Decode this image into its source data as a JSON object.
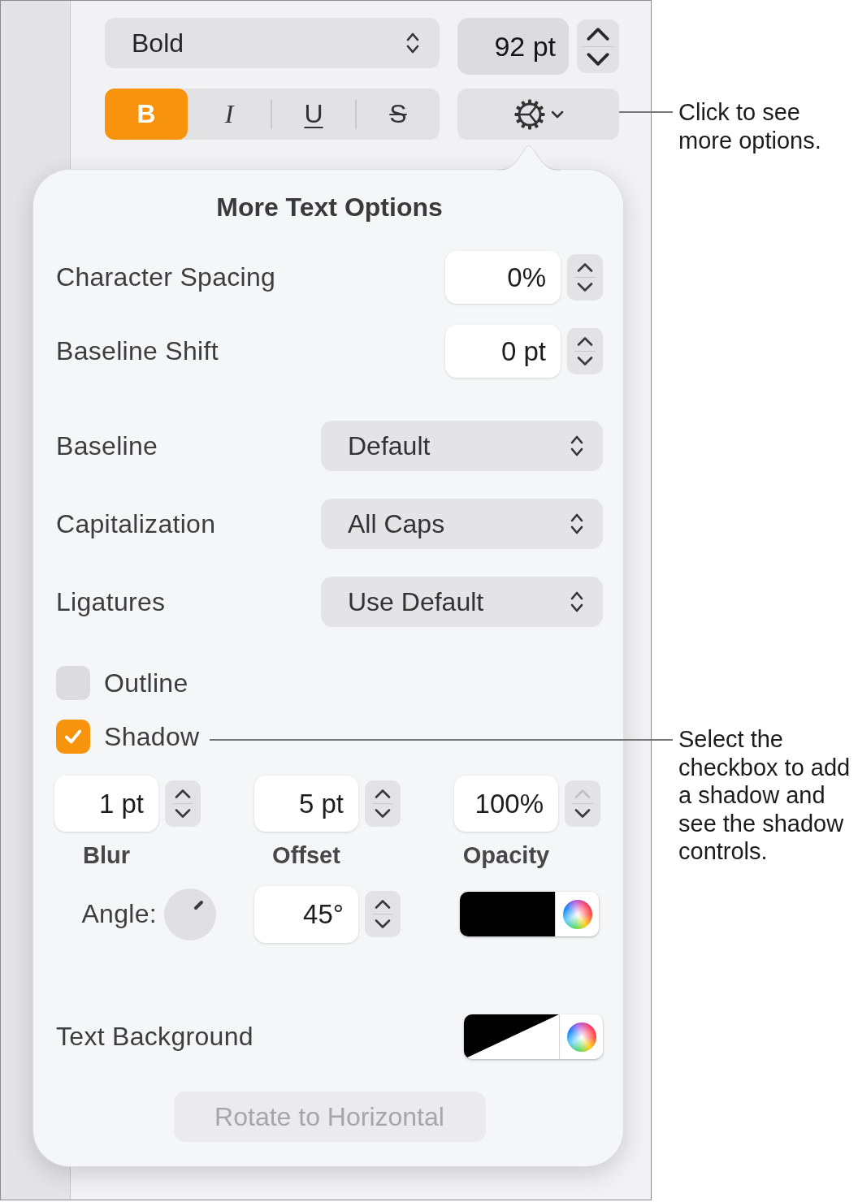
{
  "toolbar": {
    "font_style": {
      "value": "Bold"
    },
    "font_size": {
      "value": "92 pt"
    },
    "style_buttons": [
      {
        "kind": "bold",
        "label": "B",
        "selected": true
      },
      {
        "kind": "italic",
        "label": "I",
        "selected": false
      },
      {
        "kind": "underline",
        "label": "U",
        "selected": false
      },
      {
        "kind": "strikethrough",
        "label": "S",
        "selected": false
      }
    ]
  },
  "popover": {
    "title": "More Text Options",
    "number_fields": [
      {
        "label": "Character Spacing",
        "value": "0%"
      },
      {
        "label": "Baseline Shift",
        "value": "0 pt"
      }
    ],
    "dropdowns": [
      {
        "label": "Baseline",
        "value": "Default"
      },
      {
        "label": "Capitalization",
        "value": "All Caps"
      },
      {
        "label": "Ligatures",
        "value": "Use Default"
      }
    ],
    "checkboxes": [
      {
        "label": "Outline",
        "checked": false
      },
      {
        "label": "Shadow",
        "checked": true
      }
    ],
    "shadow": {
      "controls": [
        {
          "label": "Blur",
          "value": "1 pt",
          "increment_disabled": false
        },
        {
          "label": "Offset",
          "value": "5 pt",
          "increment_disabled": false
        },
        {
          "label": "Opacity",
          "value": "100%",
          "increment_disabled": true
        }
      ],
      "angle": {
        "label": "Angle:",
        "value": "45°"
      }
    },
    "text_background": {
      "label": "Text Background"
    },
    "rotate_button": {
      "label": "Rotate to Horizontal",
      "disabled": true
    }
  },
  "callouts": [
    {
      "text": "Click to see more options."
    },
    {
      "text": "Select the checkbox to add a shadow and see the shadow controls."
    }
  ]
}
